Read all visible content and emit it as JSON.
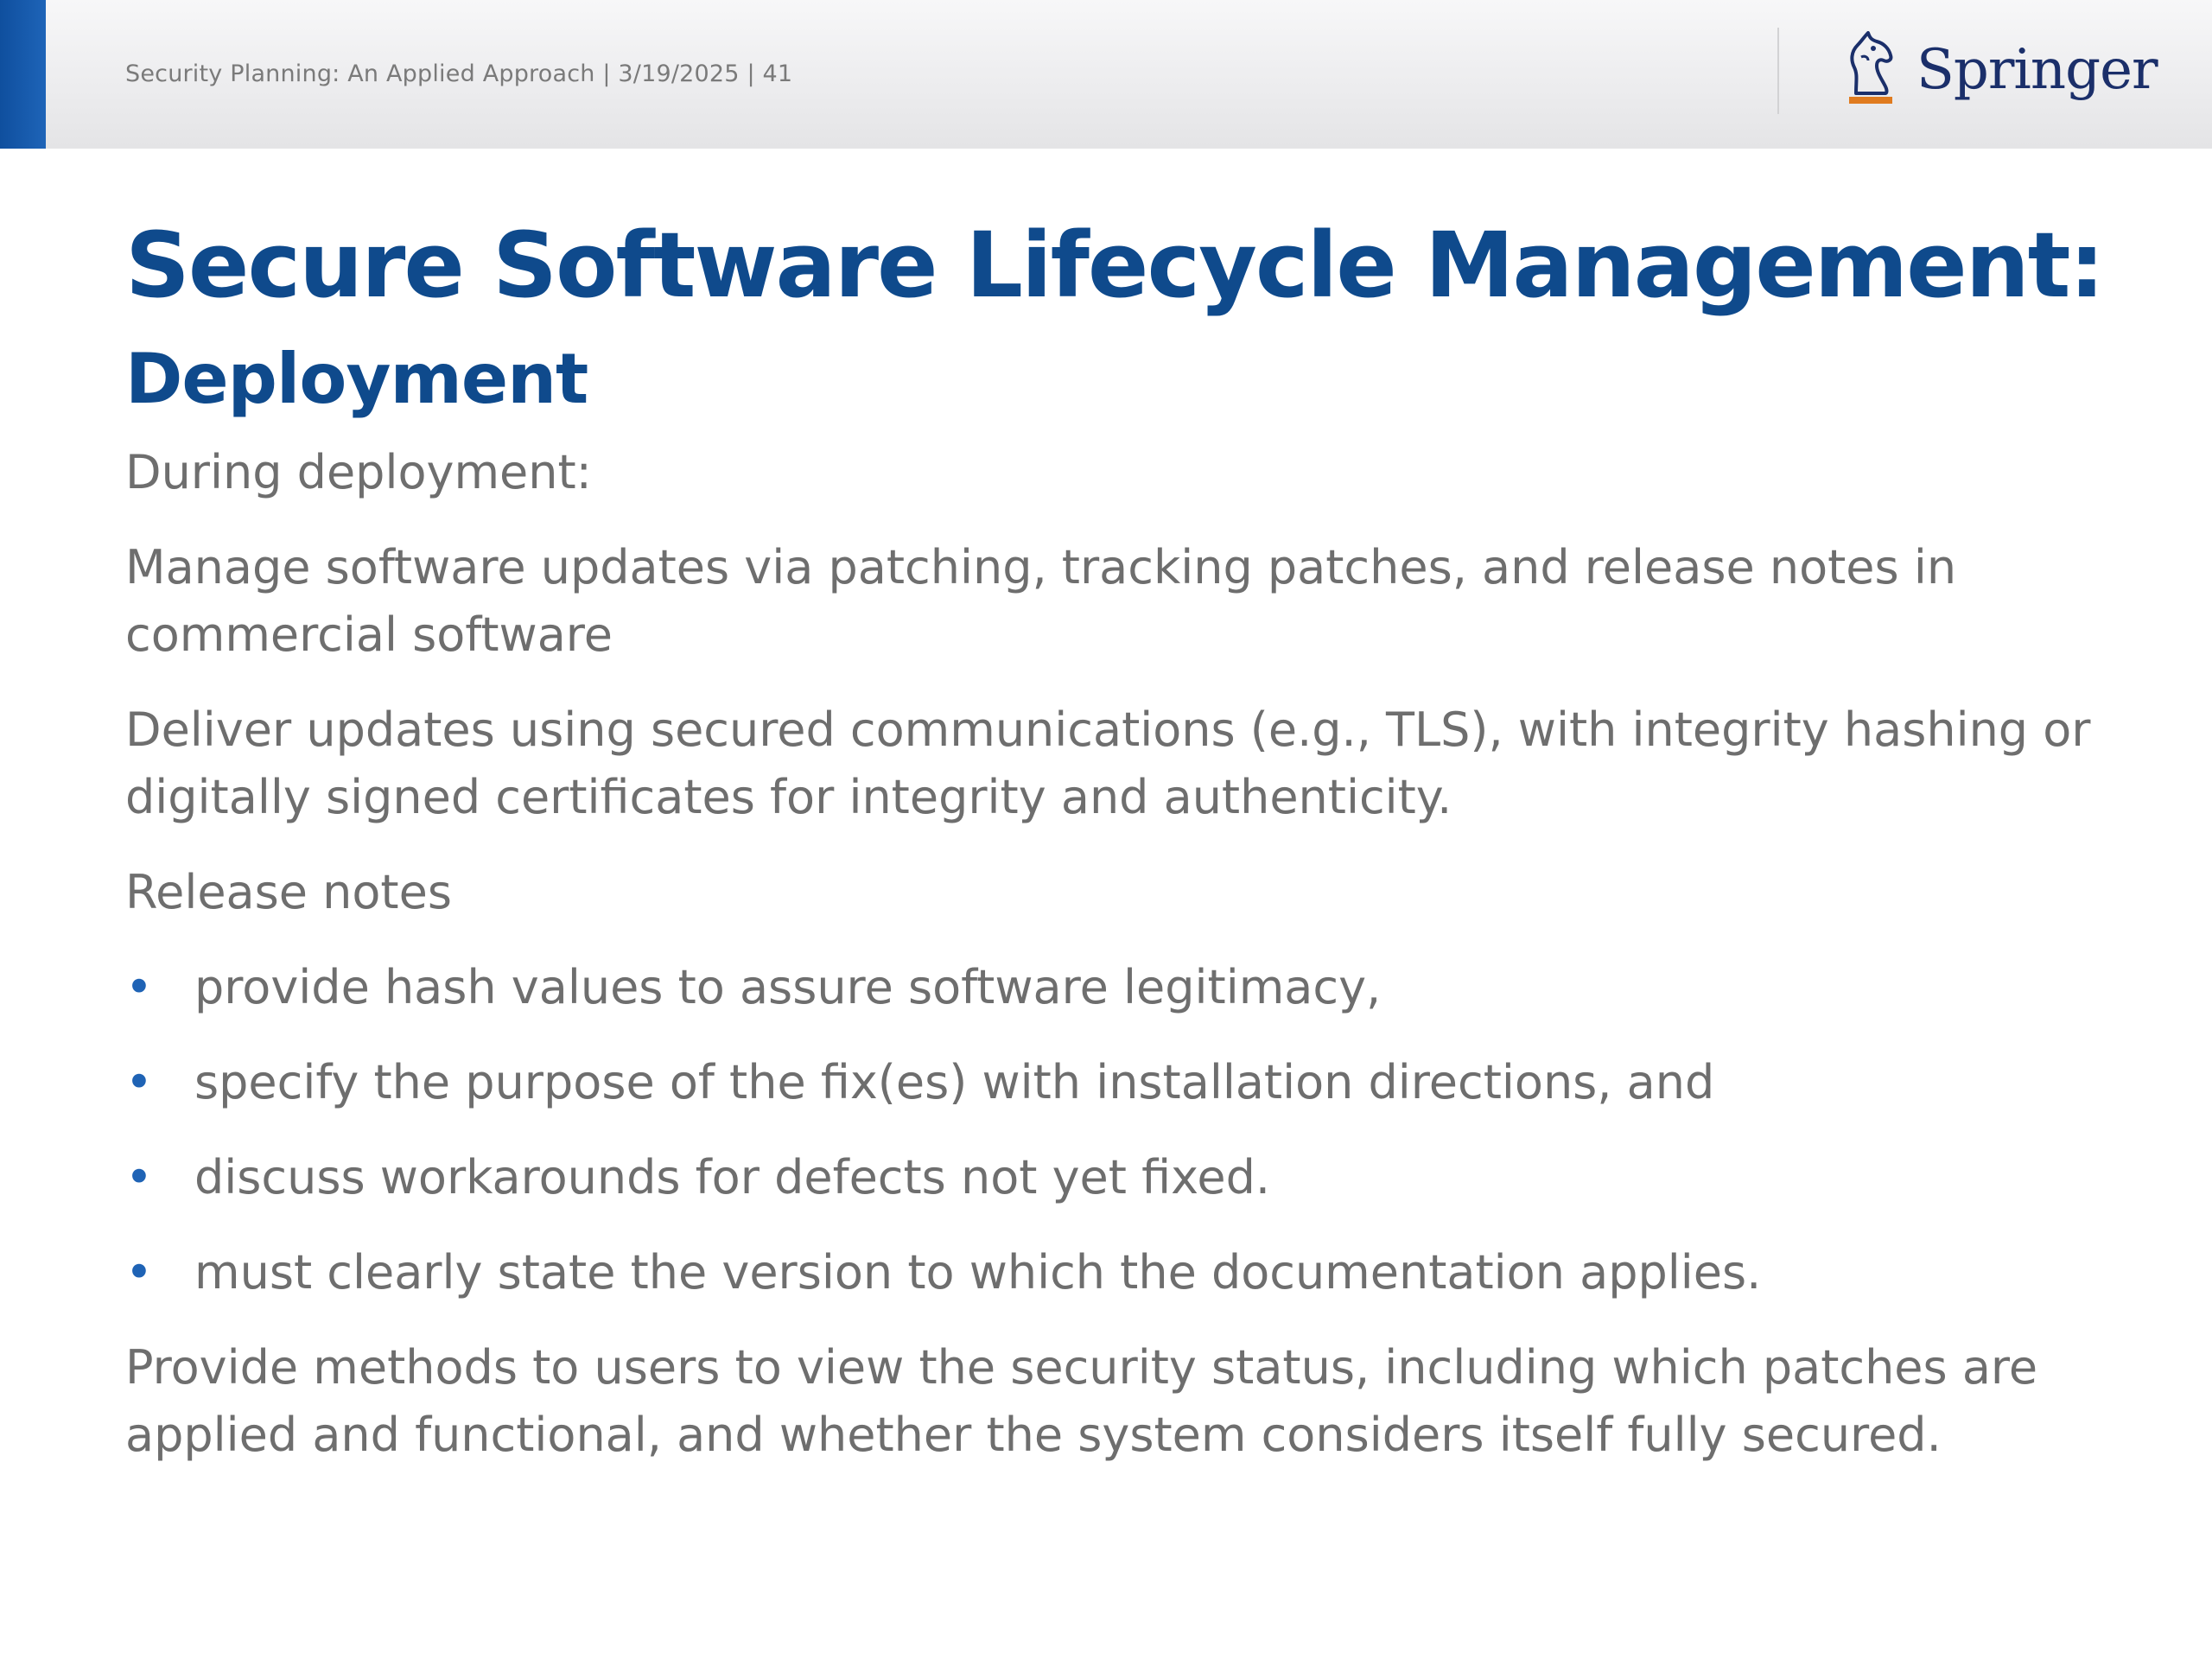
{
  "header": {
    "footer_text": "Security Planning: An Applied Approach | 3/19/2025 | 41",
    "logo_text": "Springer",
    "accent_color": "#0f4f9e"
  },
  "slide": {
    "title": "Secure Software Lifecycle Management:",
    "subtitle": "Deployment",
    "intro": "During deployment:",
    "paragraphs": [
      "Manage software updates via patching, tracking patches, and release notes in commercial software",
      "Deliver updates using secured communications (e.g., TLS), with integrity hashing or digitally signed certificates for integrity and authenticity.",
      "Release notes"
    ],
    "bullets": [
      "provide hash values to assure software legitimacy,",
      "specify the purpose of the fix(es) with installation directions, and",
      "discuss workarounds for defects not yet fixed.",
      "must clearly state the version to which the documentation applies."
    ],
    "bullet_symbol": "•",
    "closing": "Provide methods to users to view the security status, including which patches are applied and functional, and whether the system considers itself fully secured."
  },
  "colors": {
    "title": "#0f4a8c",
    "body_text": "#6e6e6e",
    "bullet": "#1f63b5"
  }
}
